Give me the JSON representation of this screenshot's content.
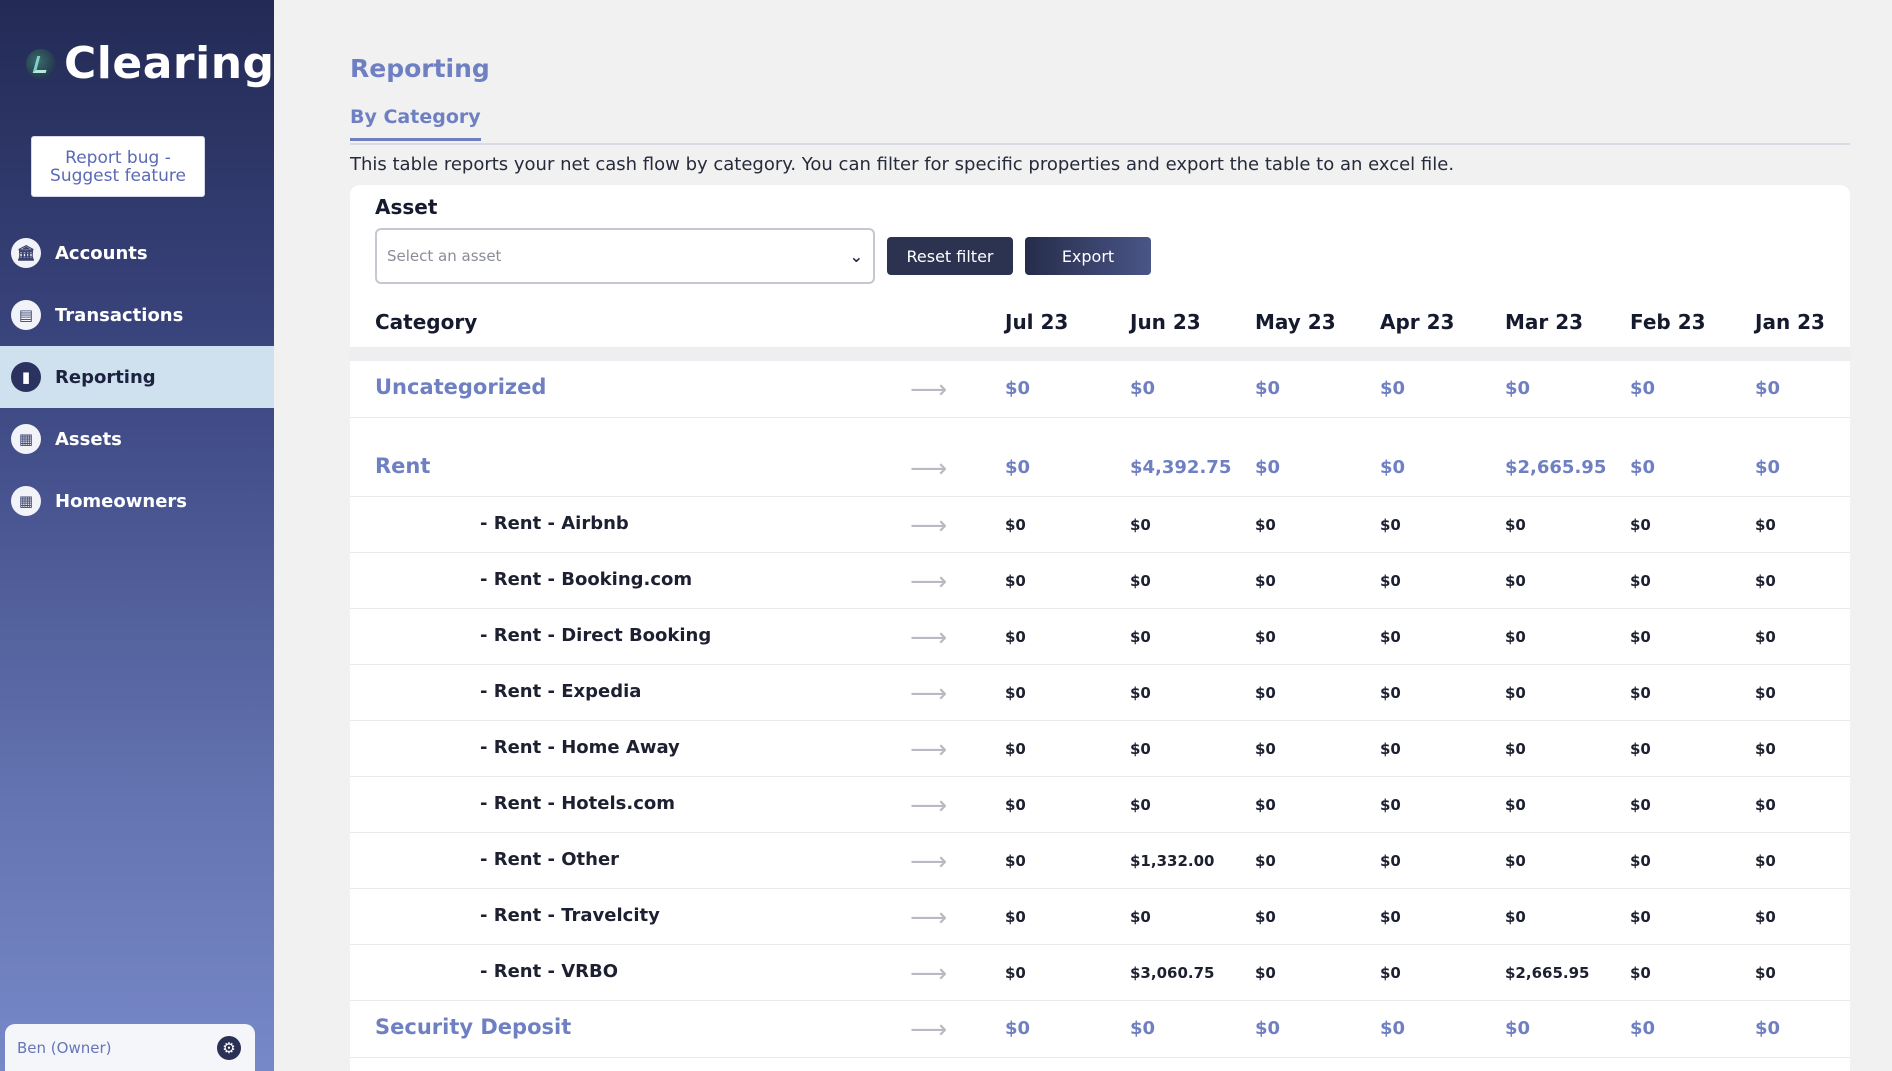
{
  "sidebar": {
    "brand": "Clearing",
    "report_button": "Report bug - Suggest feature",
    "nav": [
      {
        "label": "Accounts",
        "icon": "bank-icon"
      },
      {
        "label": "Transactions",
        "icon": "document-icon"
      },
      {
        "label": "Reporting",
        "icon": "bar-chart-icon",
        "active": true
      },
      {
        "label": "Assets",
        "icon": "building-icon"
      },
      {
        "label": "Homeowners",
        "icon": "building-icon"
      }
    ],
    "user": "Ben (Owner)"
  },
  "main": {
    "title": "Reporting",
    "tab": "By Category",
    "description": "This table reports your net cash flow by category. You can filter for specific properties and export the table to an excel file.",
    "asset_label": "Asset",
    "asset_placeholder": "Select an asset",
    "reset_button": "Reset filter",
    "export_button": "Export"
  },
  "table": {
    "header": [
      "Category",
      "Jul 23",
      "Jun 23",
      "May 23",
      "Apr 23",
      "Mar 23",
      "Feb 23",
      "Jan 23"
    ],
    "rows": [
      {
        "type": "cat",
        "name": "Uncategorized",
        "values": [
          "$0",
          "$0",
          "$0",
          "$0",
          "$0",
          "$0",
          "$0"
        ]
      },
      {
        "type": "spacer"
      },
      {
        "type": "cat",
        "name": "Rent",
        "values": [
          "$0",
          "$4,392.75",
          "$0",
          "$0",
          "$2,665.95",
          "$0",
          "$0"
        ]
      },
      {
        "type": "sub",
        "name": "-  Rent - Airbnb",
        "values": [
          "$0",
          "$0",
          "$0",
          "$0",
          "$0",
          "$0",
          "$0"
        ]
      },
      {
        "type": "sub",
        "name": "-  Rent - Booking.com",
        "values": [
          "$0",
          "$0",
          "$0",
          "$0",
          "$0",
          "$0",
          "$0"
        ]
      },
      {
        "type": "sub",
        "name": "-  Rent - Direct Booking",
        "values": [
          "$0",
          "$0",
          "$0",
          "$0",
          "$0",
          "$0",
          "$0"
        ]
      },
      {
        "type": "sub",
        "name": "-  Rent - Expedia",
        "values": [
          "$0",
          "$0",
          "$0",
          "$0",
          "$0",
          "$0",
          "$0"
        ]
      },
      {
        "type": "sub",
        "name": "-  Rent - Home Away",
        "values": [
          "$0",
          "$0",
          "$0",
          "$0",
          "$0",
          "$0",
          "$0"
        ]
      },
      {
        "type": "sub",
        "name": "-  Rent - Hotels.com",
        "values": [
          "$0",
          "$0",
          "$0",
          "$0",
          "$0",
          "$0",
          "$0"
        ]
      },
      {
        "type": "sub",
        "name": "-  Rent - Other",
        "values": [
          "$0",
          "$1,332.00",
          "$0",
          "$0",
          "$0",
          "$0",
          "$0"
        ]
      },
      {
        "type": "sub",
        "name": "-  Rent - Travelcity",
        "values": [
          "$0",
          "$0",
          "$0",
          "$0",
          "$0",
          "$0",
          "$0"
        ]
      },
      {
        "type": "sub",
        "name": "-  Rent - VRBO",
        "values": [
          "$0",
          "$3,060.75",
          "$0",
          "$0",
          "$2,665.95",
          "$0",
          "$0"
        ]
      },
      {
        "type": "cat",
        "name": "Security Deposit",
        "values": [
          "$0",
          "$0",
          "$0",
          "$0",
          "$0",
          "$0",
          "$0"
        ]
      }
    ]
  }
}
